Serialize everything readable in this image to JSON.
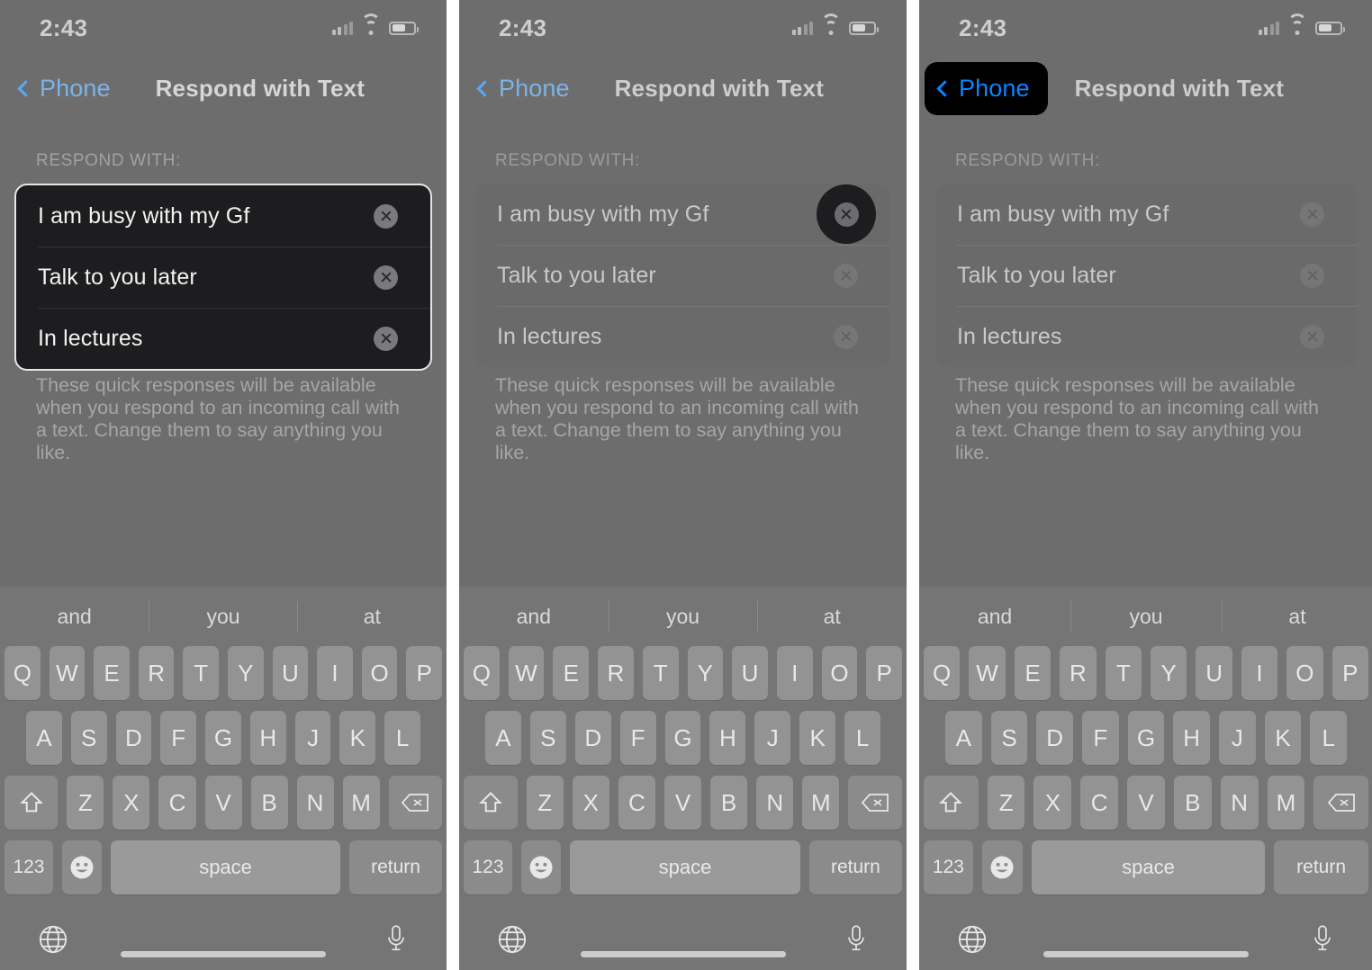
{
  "status_bar": {
    "time": "2:43",
    "signal_icon": "cellular-signal-icon",
    "wifi_icon": "wifi-icon",
    "battery_icon": "battery-icon"
  },
  "nav": {
    "back_label": "Phone",
    "back_chevron_icon": "chevron-left-icon",
    "title": "Respond with Text"
  },
  "section": {
    "header": "RESPOND WITH:"
  },
  "responses": [
    {
      "text": "I am busy with my Gf",
      "delete_icon": "delete-circle-x-icon"
    },
    {
      "text": "Talk to you later",
      "delete_icon": "delete-circle-x-icon"
    },
    {
      "text": "In lectures",
      "delete_icon": "delete-circle-x-icon"
    }
  ],
  "note": "These quick responses will be available when you respond to an incoming call with a text. Change them to say anything you like.",
  "keyboard": {
    "suggestions": [
      "and",
      "you",
      "at"
    ],
    "row1": [
      "Q",
      "W",
      "E",
      "R",
      "T",
      "Y",
      "U",
      "I",
      "O",
      "P"
    ],
    "row2": [
      "A",
      "S",
      "D",
      "F",
      "G",
      "H",
      "J",
      "K",
      "L"
    ],
    "row3": [
      "Z",
      "X",
      "C",
      "V",
      "B",
      "N",
      "M"
    ],
    "shift_icon": "shift-arrow-up-icon",
    "backspace_icon": "backspace-delete-icon",
    "numbers_label": "123",
    "emoji_icon": "emoji-smiley-icon",
    "space_label": "space",
    "return_label": "return",
    "globe_icon": "globe-language-icon",
    "mic_icon": "microphone-icon"
  },
  "colors": {
    "accent_blue": "#0a84ff",
    "back_link_blue": "#7bb4e8",
    "panel_background": "#6d6d6d",
    "card_active": "#1d1d1f",
    "spotlight": "#000000"
  },
  "panels": [
    {
      "id": "panel-1",
      "spotlight": "responses-card"
    },
    {
      "id": "panel-2",
      "spotlight": "first-delete-button"
    },
    {
      "id": "panel-3",
      "spotlight": "back-button"
    }
  ]
}
